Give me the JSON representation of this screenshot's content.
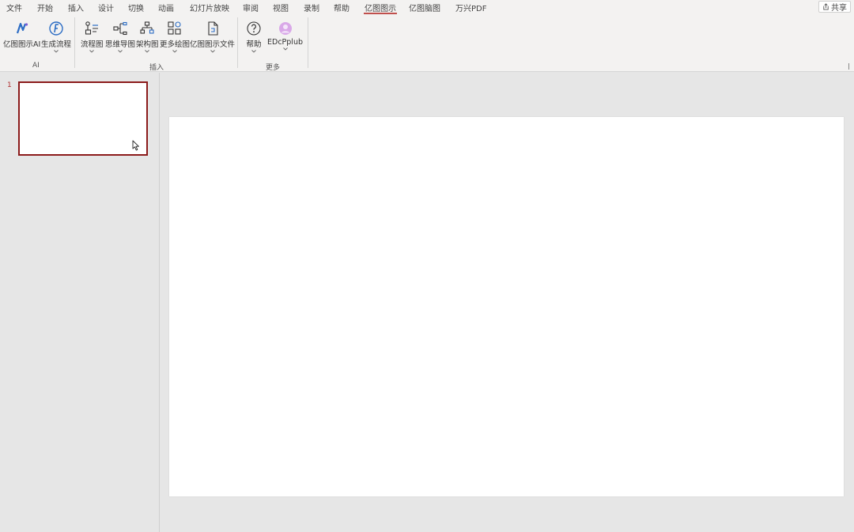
{
  "menu": {
    "tabs": [
      {
        "label": "文件",
        "active": false
      },
      {
        "label": "开始",
        "active": false
      },
      {
        "label": "插入",
        "active": false
      },
      {
        "label": "设计",
        "active": false
      },
      {
        "label": "切换",
        "active": false
      },
      {
        "label": "动画",
        "active": false
      },
      {
        "label": "幻灯片放映",
        "active": false
      },
      {
        "label": "审阅",
        "active": false
      },
      {
        "label": "视图",
        "active": false
      },
      {
        "label": "录制",
        "active": false
      },
      {
        "label": "帮助",
        "active": false
      },
      {
        "label": "亿图图示",
        "active": true
      },
      {
        "label": "亿图脑图",
        "active": false
      },
      {
        "label": "万兴PDF",
        "active": false
      }
    ],
    "share_label": "共享"
  },
  "ribbon": {
    "groups": {
      "ai": {
        "label": "AI",
        "buttons": [
          {
            "label": "亿图图示AI",
            "icon": "edraw-ai-icon"
          },
          {
            "label": "生成流程",
            "icon": "flowchart-ai-icon"
          }
        ]
      },
      "insert": {
        "label": "插入",
        "buttons": [
          {
            "label": "流程图",
            "icon": "flowchart-icon"
          },
          {
            "label": "思维导图",
            "icon": "mindmap-icon"
          },
          {
            "label": "架构图",
            "icon": "orgchart-icon"
          },
          {
            "label": "更多绘图",
            "icon": "more-diagrams-icon"
          },
          {
            "label": "亿图图示文件",
            "icon": "edraw-file-icon"
          }
        ]
      },
      "more": {
        "label": "更多",
        "buttons": [
          {
            "label": "帮助",
            "icon": "help-icon"
          },
          {
            "label": "EDcPplub",
            "icon": "avatar-icon"
          }
        ]
      }
    }
  },
  "thumbnails": [
    {
      "number": "1"
    }
  ],
  "colors": {
    "accent": "#8b1a1a",
    "ribbon_bg": "#f3f2f1",
    "workspace_bg": "#e6e6e6",
    "icon_blue": "#2b6cc4"
  }
}
